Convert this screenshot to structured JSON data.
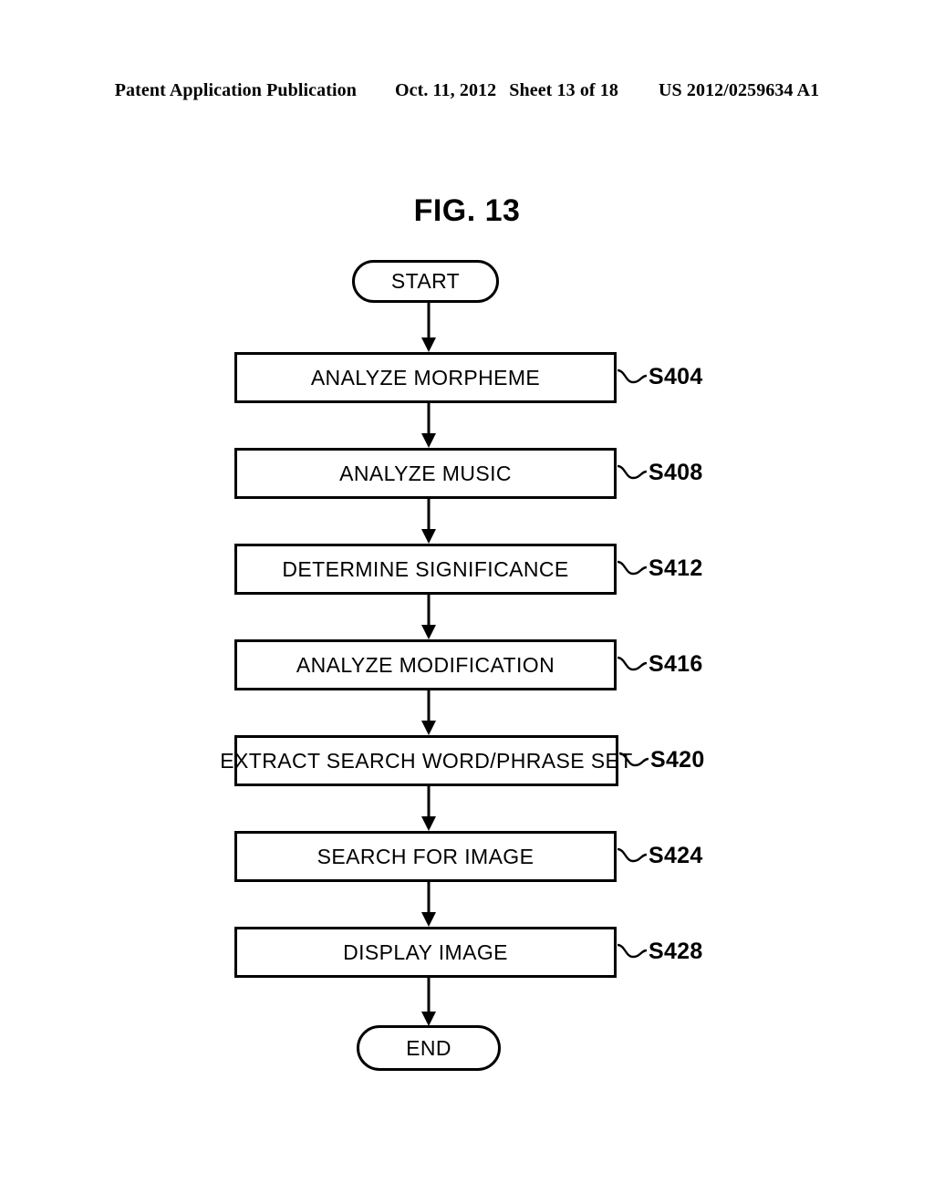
{
  "header": {
    "publication": "Patent Application Publication",
    "date": "Oct. 11, 2012",
    "sheet": "Sheet 13 of 18",
    "number": "US 2012/0259634 A1"
  },
  "figure": {
    "title": "FIG. 13",
    "type": "flowchart",
    "ink_color": "#000000",
    "background_color": "#ffffff"
  },
  "flowchart": {
    "start": {
      "label": "START",
      "shape": "terminator"
    },
    "end": {
      "label": "END",
      "shape": "terminator"
    },
    "steps": [
      {
        "label": "ANALYZE MORPHEME",
        "ref": "S404",
        "shape": "process"
      },
      {
        "label": "ANALYZE MUSIC",
        "ref": "S408",
        "shape": "process"
      },
      {
        "label": "DETERMINE SIGNIFICANCE",
        "ref": "S412",
        "shape": "process"
      },
      {
        "label": "ANALYZE MODIFICATION",
        "ref": "S416",
        "shape": "process"
      },
      {
        "label": "EXTRACT SEARCH WORD/PHRASE SET",
        "ref": "S420",
        "shape": "process"
      },
      {
        "label": "SEARCH FOR IMAGE",
        "ref": "S424",
        "shape": "process"
      },
      {
        "label": "DISPLAY IMAGE",
        "ref": "S428",
        "shape": "process"
      }
    ]
  }
}
